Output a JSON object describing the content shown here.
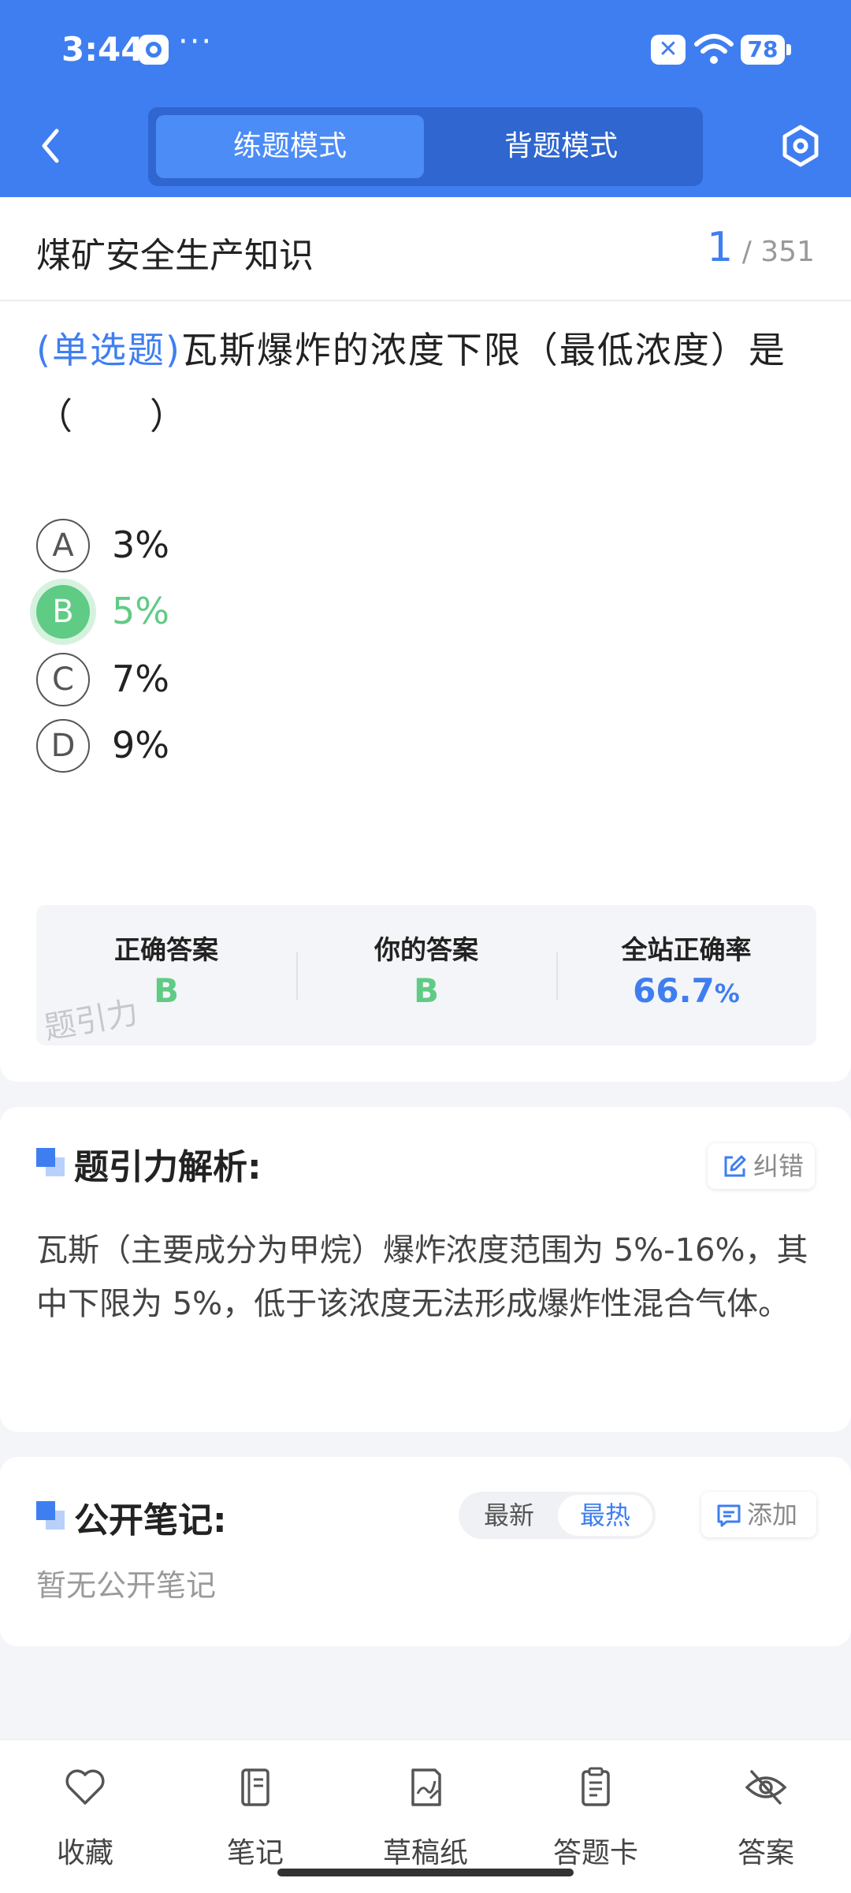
{
  "status_bar": {
    "time": "3:44",
    "dots": "···",
    "battery": "78"
  },
  "header": {
    "tabs": [
      {
        "label": "练题模式",
        "active": true
      },
      {
        "label": "背题模式",
        "active": false
      }
    ]
  },
  "question_card": {
    "subject": "煤矿安全生产知识",
    "counter_current": "1",
    "counter_total": "/ 351",
    "question_type": "(单选题)",
    "question_text": "瓦斯爆炸的浓度下限（最低浓度）是（　　）",
    "options": [
      {
        "letter": "A",
        "text": "3%",
        "state": "normal"
      },
      {
        "letter": "B",
        "text": "5%",
        "state": "correct"
      },
      {
        "letter": "C",
        "text": "7%",
        "state": "normal"
      },
      {
        "letter": "D",
        "text": "9%",
        "state": "normal"
      }
    ],
    "answer_summary": {
      "correct_label": "正确答案",
      "correct_value": "B",
      "yours_label": "你的答案",
      "yours_value": "B",
      "rate_label": "全站正确率",
      "rate_value": "66.7",
      "rate_unit": "%",
      "watermark": "题引力"
    }
  },
  "analysis": {
    "title": "题引力解析:",
    "report_button": "纠错",
    "text": "瓦斯（主要成分为甲烷）爆炸浓度范围为 5%-16%，其中下限为 5%，低于该浓度无法形成爆炸性混合气体。"
  },
  "notes": {
    "title": "公开笔记:",
    "sort_latest": "最新",
    "sort_hot": "最热",
    "add_button": "添加",
    "empty_text": "暂无公开笔记"
  },
  "bottom_nav": [
    {
      "label": "收藏",
      "icon": "heart-icon"
    },
    {
      "label": "笔记",
      "icon": "notebook-icon"
    },
    {
      "label": "草稿纸",
      "icon": "draft-paper-icon"
    },
    {
      "label": "答题卡",
      "icon": "answer-card-icon"
    },
    {
      "label": "答案",
      "icon": "eye-off-icon"
    }
  ],
  "colors": {
    "primary": "#3f7ef0",
    "correct": "#5fcb84",
    "background": "#f4f5f8"
  }
}
